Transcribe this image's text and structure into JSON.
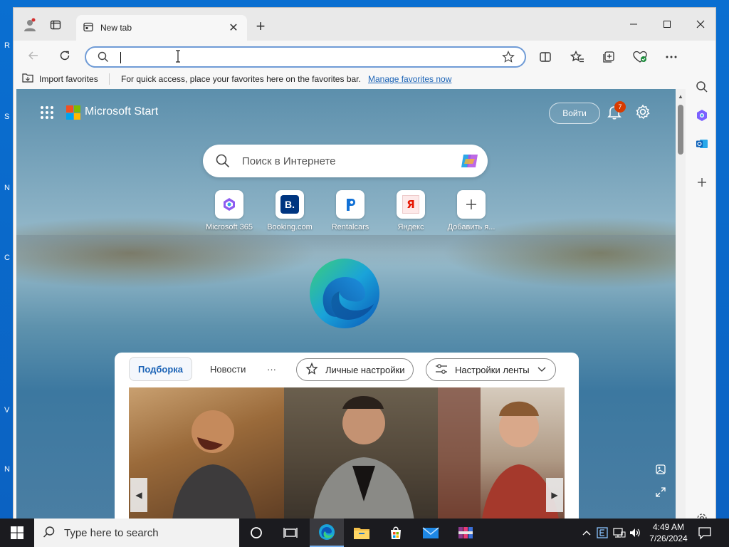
{
  "desktop": {
    "fragments": [
      "R",
      "S",
      "N",
      "C",
      "V",
      "N"
    ]
  },
  "browser": {
    "tab": {
      "title": "New tab"
    },
    "address": {
      "value": "",
      "placeholder": ""
    },
    "favorites_bar": {
      "import_label": "Import favorites",
      "message": "For quick access, place your favorites here on the favorites bar.",
      "manage_link": "Manage favorites now"
    }
  },
  "newtab": {
    "brand": "Microsoft Start",
    "signin": "Войти",
    "notifications_count": "7",
    "search_placeholder": "Поиск в Интернете",
    "tiles": [
      {
        "label": "Microsoft 365",
        "icon": "microsoft365-icon"
      },
      {
        "label": "Booking.com",
        "icon": "booking-icon"
      },
      {
        "label": "Rentalcars",
        "icon": "rentalcars-icon"
      },
      {
        "label": "Яндекс",
        "icon": "yandex-icon"
      },
      {
        "label": "Добавить я...",
        "icon": "plus-icon"
      }
    ],
    "feed": {
      "tabs": [
        "Подборка",
        "Новости",
        "···"
      ],
      "personal_settings": "Личные настройки",
      "feed_settings": "Настройки ленты"
    }
  },
  "taskbar": {
    "search_placeholder": "Type here to search",
    "time": "4:49 AM",
    "date": "7/26/2024"
  },
  "colors": {
    "accent": "#1b63b6",
    "badge": "#d83b01",
    "taskbar": "#1b1b1f"
  }
}
